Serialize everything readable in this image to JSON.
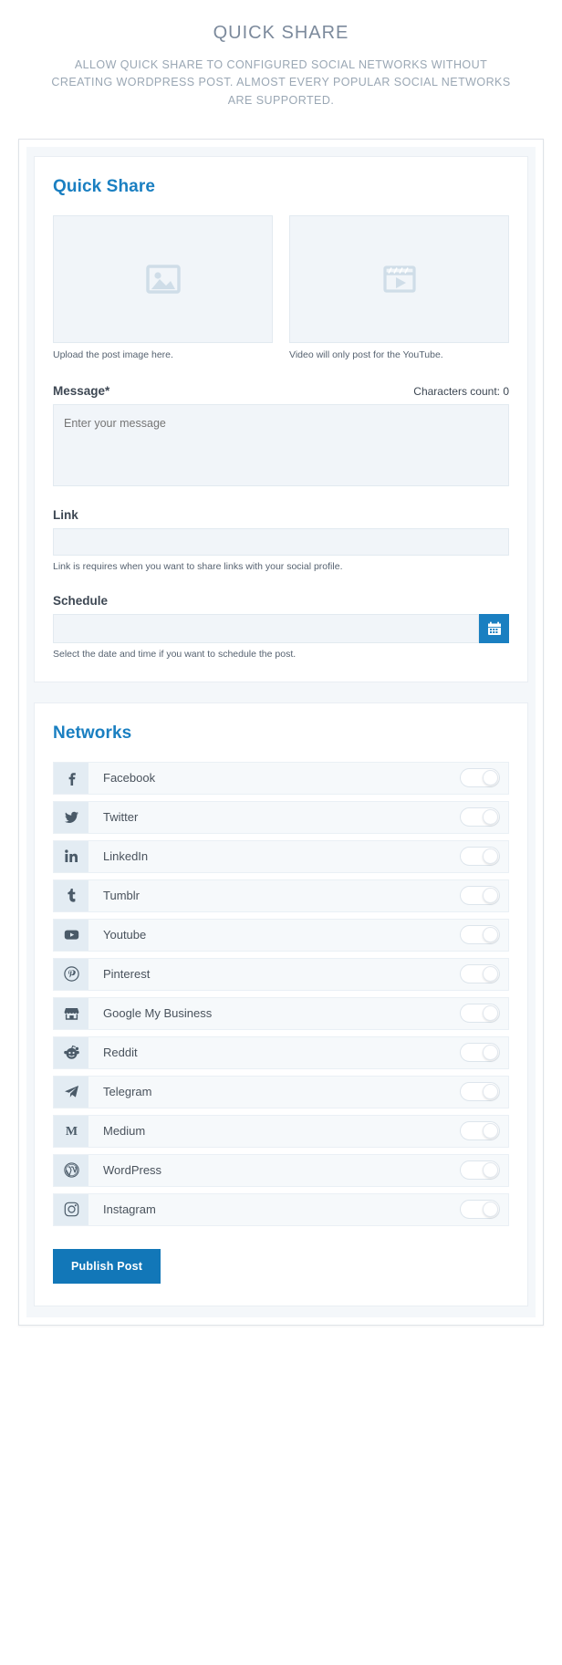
{
  "header": {
    "title": "QUICK SHARE",
    "subtitle": "ALLOW QUICK SHARE TO CONFIGURED SOCIAL NETWORKS WITHOUT CREATING WORDPRESS POST. ALMOST EVERY POPULAR SOCIAL NETWORKS ARE SUPPORTED."
  },
  "colors": {
    "accent": "#1a7fc1",
    "publish_button": "#1277b8",
    "field_bg": "#f1f5f9",
    "icon_tile_bg": "#e3ecf3",
    "title_text": "#7c8a9c"
  },
  "quick_share": {
    "title": "Quick Share",
    "image_upload": {
      "icon": "image-placeholder-icon",
      "caption": "Upload the post image here."
    },
    "video_upload": {
      "icon": "video-placeholder-icon",
      "caption": "Video will only post for the YouTube."
    },
    "message": {
      "label": "Message*",
      "characters_count": "Characters count: 0",
      "placeholder": "Enter your message",
      "value": ""
    },
    "link": {
      "label": "Link",
      "placeholder": "",
      "value": "",
      "helper": "Link is requires when you want to share links with your social profile."
    },
    "schedule": {
      "label": "Schedule",
      "placeholder": "",
      "value": "",
      "helper": "Select the date and time if you want to schedule the post.",
      "calendar_icon": "calendar-icon"
    }
  },
  "networks": {
    "title": "Networks",
    "items": [
      {
        "label": "Facebook",
        "icon": "facebook-icon",
        "enabled": false
      },
      {
        "label": "Twitter",
        "icon": "twitter-icon",
        "enabled": false
      },
      {
        "label": "LinkedIn",
        "icon": "linkedin-icon",
        "enabled": false
      },
      {
        "label": "Tumblr",
        "icon": "tumblr-icon",
        "enabled": false
      },
      {
        "label": "Youtube",
        "icon": "youtube-icon",
        "enabled": false
      },
      {
        "label": "Pinterest",
        "icon": "pinterest-icon",
        "enabled": false
      },
      {
        "label": "Google My Business",
        "icon": "google-my-business-icon",
        "enabled": false
      },
      {
        "label": "Reddit",
        "icon": "reddit-icon",
        "enabled": false
      },
      {
        "label": "Telegram",
        "icon": "telegram-icon",
        "enabled": false
      },
      {
        "label": "Medium",
        "icon": "medium-icon",
        "enabled": false
      },
      {
        "label": "WordPress",
        "icon": "wordpress-icon",
        "enabled": false
      },
      {
        "label": "Instagram",
        "icon": "instagram-icon",
        "enabled": false
      }
    ],
    "publish_label": "Publish Post"
  }
}
